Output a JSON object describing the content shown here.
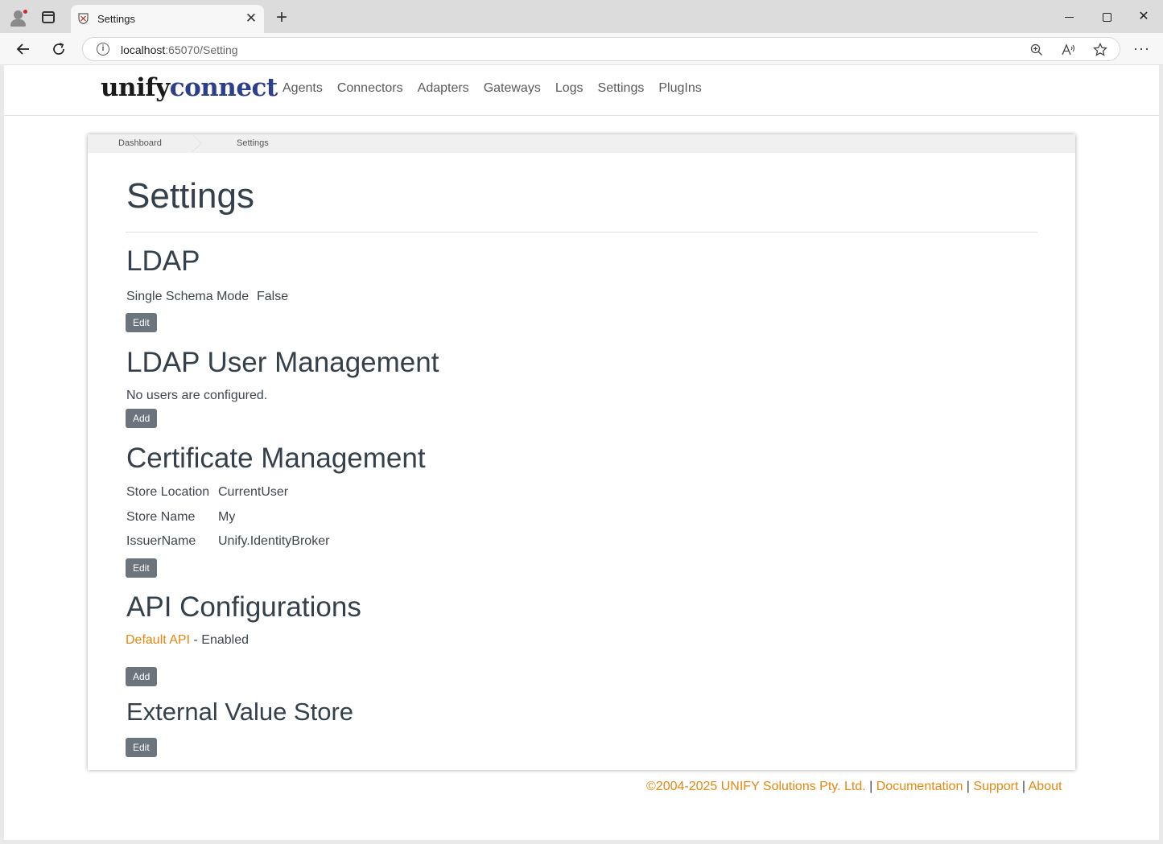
{
  "browser": {
    "tab_title": "Settings",
    "url_host": "localhost",
    "url_path": ":65070/Setting",
    "tab_close": "✕",
    "new_tab": "+",
    "window_close": "✕",
    "more": "···"
  },
  "header": {
    "logo_unify": "unify",
    "logo_connect": "connect",
    "nav": [
      "Agents",
      "Connectors",
      "Adapters",
      "Gateways",
      "Logs",
      "Settings",
      "PlugIns"
    ]
  },
  "breadcrumb": [
    "Dashboard",
    "Settings"
  ],
  "page_title": "Settings",
  "ldap": {
    "heading": "LDAP",
    "mode_label": "Single Schema Mode",
    "mode_value": "False",
    "edit_label": "Edit"
  },
  "ldap_users": {
    "heading": "LDAP User Management",
    "empty_text": "No users are configured.",
    "add_label": "Add"
  },
  "certificates": {
    "heading": "Certificate Management",
    "rows": [
      {
        "label": "Store Location",
        "value": "CurrentUser"
      },
      {
        "label": "Store Name",
        "value": "My"
      },
      {
        "label": "IssuerName",
        "value": "Unify.IdentityBroker"
      }
    ],
    "edit_label": "Edit"
  },
  "api": {
    "heading": "API Configurations",
    "item_link": "Default API",
    "item_status": " - Enabled",
    "add_label": "Add"
  },
  "external_store": {
    "heading": "External Value Store",
    "edit_label": "Edit"
  },
  "footer": {
    "copyright": "©2004-2025 UNIFY Solutions Pty. Ltd.",
    "sep": " | ",
    "documentation": "Documentation",
    "support": "Support",
    "about": "About"
  }
}
